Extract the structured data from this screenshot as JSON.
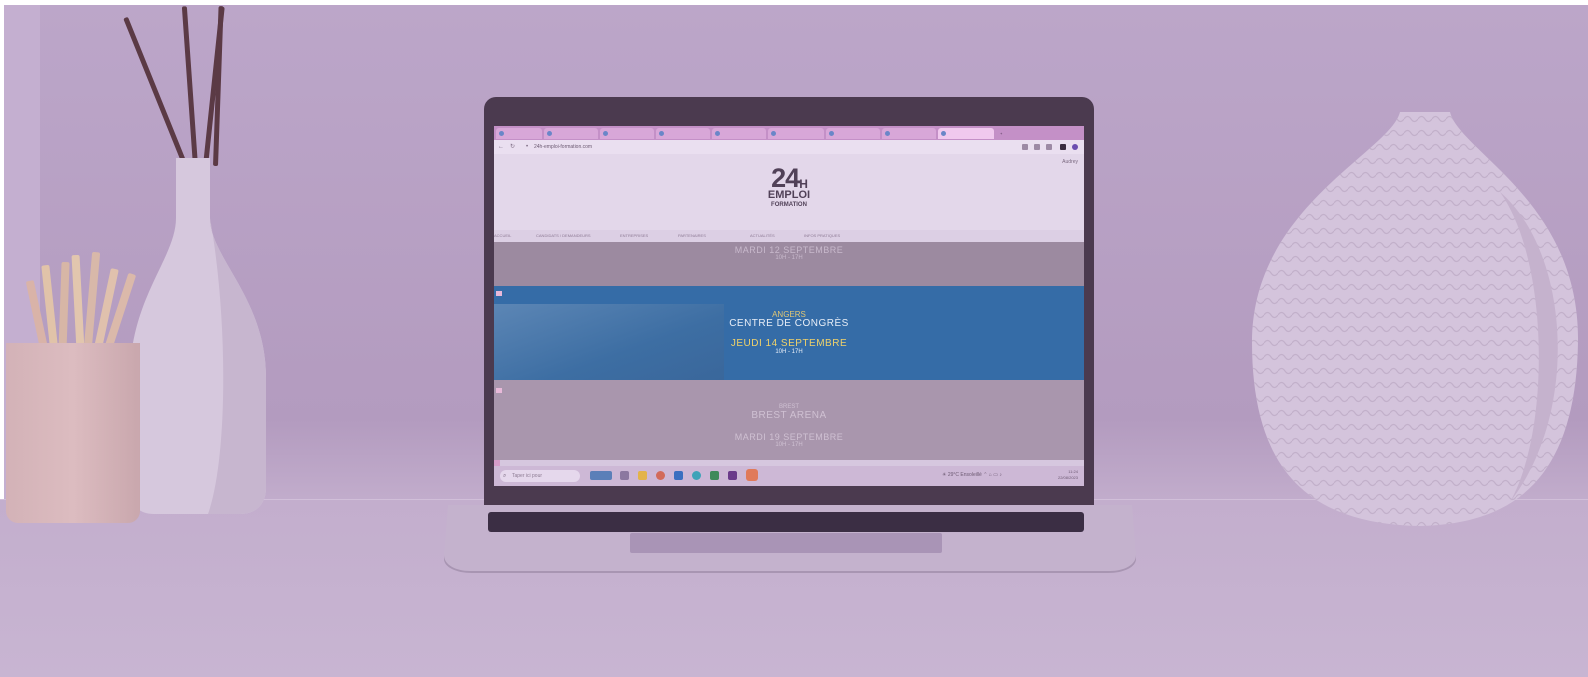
{
  "browser": {
    "tabs": [
      "",
      "",
      "",
      "",
      "",
      "",
      "",
      "",
      "",
      ""
    ],
    "url": "24h-emploi-formation.com"
  },
  "site": {
    "username": "Audrey",
    "logo": {
      "number": "24",
      "suffix": "H",
      "line1": "EMPLOI",
      "line2": "FORMATION"
    },
    "nav": [
      "ACCUEIL",
      "CANDIDATS / DEMANDEURS",
      "ENTREPRISES",
      "PARTENAIRES",
      "ACTUALITÉS",
      "INFOS PRATIQUES"
    ],
    "events": [
      {
        "tag": "",
        "city": "",
        "venue": "",
        "date": "MARDI 12 SEPTEMBRE",
        "hours": "10H - 17H"
      },
      {
        "tag": "",
        "city": "ANGERS",
        "venue": "CENTRE DE CONGRÈS",
        "date": "JEUDI 14 SEPTEMBRE",
        "hours": "10H - 17H"
      },
      {
        "tag": "",
        "city": "BREST",
        "venue": "BREST ARENA",
        "date": "MARDI 19 SEPTEMBRE",
        "hours": "10H - 17H"
      }
    ],
    "status_url": ""
  },
  "taskbar": {
    "search_placeholder": "Taper ici pour",
    "tray_text": "29°C Ensoleillé",
    "time": "11:24",
    "date": "22/08/2023"
  },
  "colors": {
    "overlay": "#b79fc4",
    "featured_band": "#356ca7",
    "accent_yellow": "#f0d26a"
  }
}
